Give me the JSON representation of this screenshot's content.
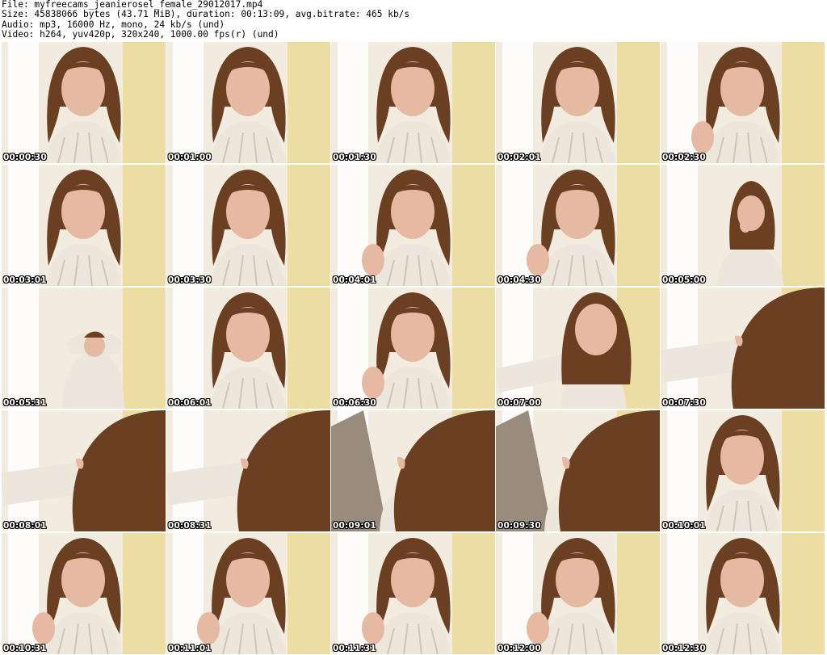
{
  "header": {
    "file": "File: myfreecams_jeanierosel_female_29012017.mp4",
    "size": "Size: 45838066 bytes (43.71 MiB), duration: 00:13:09, avg.bitrate: 465 kb/s",
    "audio": "Audio: mp3, 16000 Hz, mono, 24 kb/s (und)",
    "video": "Video: h264, yuv420p, 320x240, 1000.00 fps(r) (und)"
  },
  "thumbnails": [
    {
      "timestamp": "00:00:30",
      "scene": "face-center"
    },
    {
      "timestamp": "00:01:00",
      "scene": "face-center"
    },
    {
      "timestamp": "00:01:30",
      "scene": "face-center"
    },
    {
      "timestamp": "00:02:01",
      "scene": "face-center"
    },
    {
      "timestamp": "00:02:30",
      "scene": "face-hand"
    },
    {
      "timestamp": "00:03:01",
      "scene": "face-center"
    },
    {
      "timestamp": "00:03:30",
      "scene": "face-center"
    },
    {
      "timestamp": "00:04:01",
      "scene": "face-hand"
    },
    {
      "timestamp": "00:04:30",
      "scene": "face-hand"
    },
    {
      "timestamp": "00:05:00",
      "scene": "face-small"
    },
    {
      "timestamp": "00:05:31",
      "scene": "lean-back"
    },
    {
      "timestamp": "00:06:01",
      "scene": "face-center"
    },
    {
      "timestamp": "00:06:30",
      "scene": "face-hand"
    },
    {
      "timestamp": "00:07:00",
      "scene": "arm-out"
    },
    {
      "timestamp": "00:07:30",
      "scene": "hair-close"
    },
    {
      "timestamp": "00:08:01",
      "scene": "hair-close"
    },
    {
      "timestamp": "00:08:31",
      "scene": "hair-close"
    },
    {
      "timestamp": "00:09:01",
      "scene": "chair-hair"
    },
    {
      "timestamp": "00:09:30",
      "scene": "chair-hair"
    },
    {
      "timestamp": "00:10:01",
      "scene": "face-center"
    },
    {
      "timestamp": "00:10:31",
      "scene": "face-hand"
    },
    {
      "timestamp": "00:11:01",
      "scene": "face-hand"
    },
    {
      "timestamp": "00:11:31",
      "scene": "face-hand"
    },
    {
      "timestamp": "00:12:00",
      "scene": "face-hand"
    },
    {
      "timestamp": "00:12:30",
      "scene": "face-center"
    }
  ],
  "colors": {
    "wall": "#f1ecdf",
    "curtain": "#e9d98e",
    "hair": "#6b3f22",
    "skin": "#e6b9a2",
    "sweater": "#ece6dc",
    "chair": "#9a8c7c"
  }
}
